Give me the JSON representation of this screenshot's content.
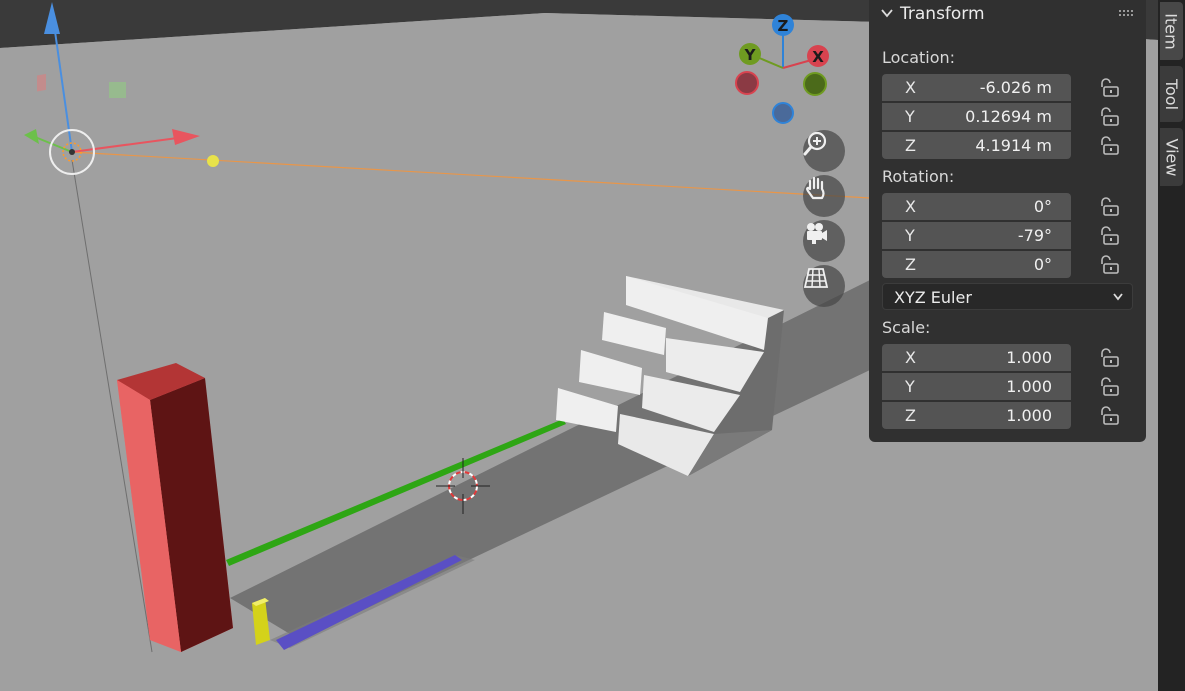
{
  "viewport": {
    "background": "#9f9f9f",
    "gizmo": {
      "z_label": "Z",
      "y_label": "Y",
      "x_label": "X"
    },
    "objects": [
      "red-pillar",
      "green-rail",
      "blue-rail",
      "yellow-block",
      "white-stairs",
      "light-gizmo",
      "3d-cursor"
    ]
  },
  "nav_buttons": [
    {
      "name": "zoom",
      "icon": "zoom-in-icon"
    },
    {
      "name": "pan",
      "icon": "hand-icon"
    },
    {
      "name": "camera",
      "icon": "camera-icon"
    },
    {
      "name": "ortho",
      "icon": "grid-icon"
    }
  ],
  "panel": {
    "title": "Transform",
    "location": {
      "label": "Location:",
      "x": {
        "axis": "X",
        "value": "-6.026 m"
      },
      "y": {
        "axis": "Y",
        "value": "0.12694 m"
      },
      "z": {
        "axis": "Z",
        "value": "4.1914 m"
      }
    },
    "rotation": {
      "label": "Rotation:",
      "x": {
        "axis": "X",
        "value": "0°"
      },
      "y": {
        "axis": "Y",
        "value": "-79°"
      },
      "z": {
        "axis": "Z",
        "value": "0°"
      },
      "mode": "XYZ Euler"
    },
    "scale": {
      "label": "Scale:",
      "x": {
        "axis": "X",
        "value": "1.000"
      },
      "y": {
        "axis": "Y",
        "value": "1.000"
      },
      "z": {
        "axis": "Z",
        "value": "1.000"
      }
    }
  },
  "tabs": [
    {
      "label": "Item",
      "active": true
    },
    {
      "label": "Tool",
      "active": false
    },
    {
      "label": "View",
      "active": false
    }
  ],
  "colors": {
    "axis_x": "#d8434f",
    "axis_y": "#6f9b21",
    "axis_z": "#2f83d8",
    "panel_bg": "#303030",
    "field_bg": "#545454"
  }
}
